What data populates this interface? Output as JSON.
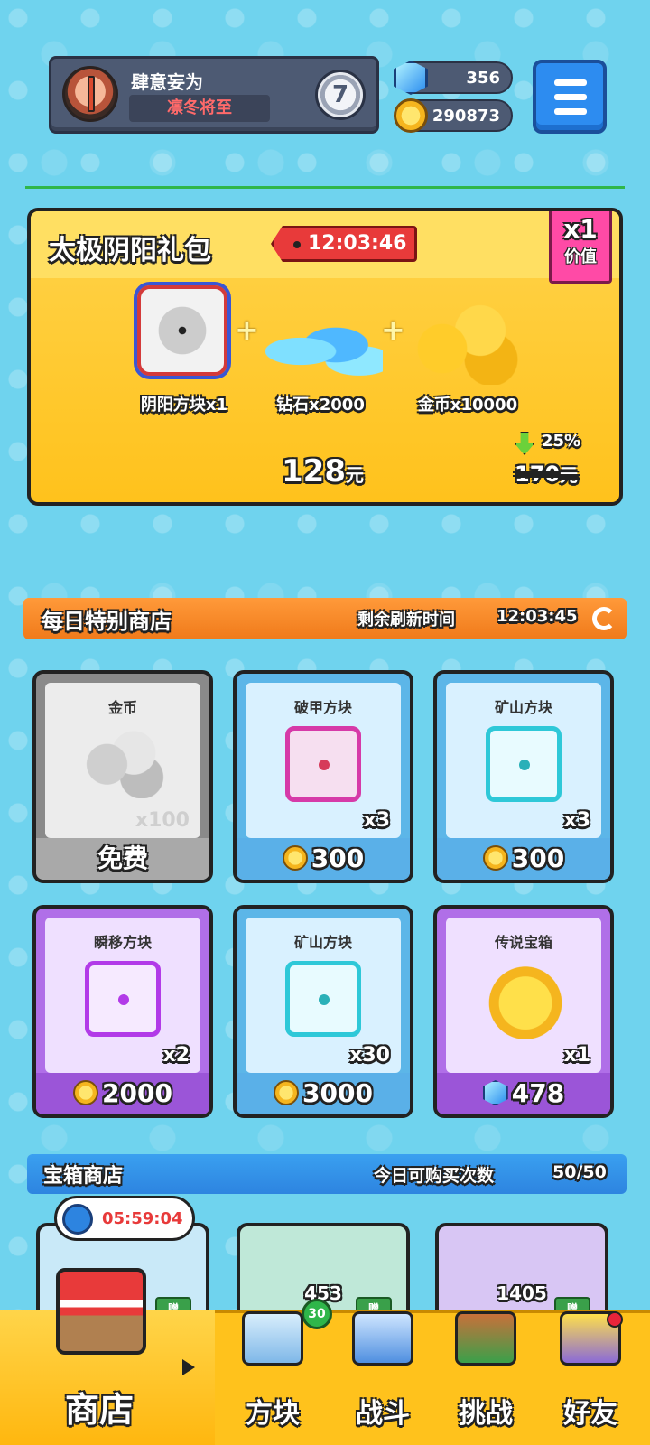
{
  "header": {
    "player_name": "肆意妄为",
    "player_title": "凛冬将至",
    "rank": "7",
    "gems": "356",
    "coins": "290873"
  },
  "gift_pack": {
    "title": "太极阴阳礼包",
    "timer": "12:03:46",
    "multiplier": "x1",
    "multiplier_label": "价值",
    "items": [
      {
        "label": "阴阳方块x1"
      },
      {
        "label": "钻石x2000"
      },
      {
        "label": "金币x10000"
      }
    ],
    "discount": "25%",
    "price": "128",
    "price_unit": "元",
    "original_price": "170",
    "original_unit": "元"
  },
  "daily_shop": {
    "title": "每日特别商店",
    "refresh_label": "剩余刷新时间",
    "refresh_time": "12:03:45",
    "items": [
      {
        "name": "金币",
        "qty": "x100",
        "price": "免费"
      },
      {
        "name": "破甲方块",
        "qty": "x3",
        "price": "300"
      },
      {
        "name": "矿山方块",
        "qty": "x3",
        "price": "300"
      },
      {
        "name": "瞬移方块",
        "qty": "x2",
        "price": "2000"
      },
      {
        "name": "矿山方块",
        "qty": "x30",
        "price": "3000"
      },
      {
        "name": "传说宝箱",
        "qty": "x1",
        "price": "478"
      }
    ]
  },
  "chest_shop": {
    "title": "宝箱商店",
    "count_label": "今日可购买次数",
    "count": "50/50",
    "timer": "05:59:04",
    "chests": [
      {
        "num": "",
        "badge": "赠"
      },
      {
        "num": "453",
        "badge": "赠",
        "level": "30"
      },
      {
        "num": "1405",
        "badge": "赠"
      }
    ]
  },
  "bottom_nav": {
    "items": [
      {
        "label": "商店"
      },
      {
        "label": "方块"
      },
      {
        "label": "战斗"
      },
      {
        "label": "挑战"
      },
      {
        "label": "好友"
      }
    ]
  },
  "colors": {
    "background": "#6fd3ee",
    "accent_orange": "#f07a1a",
    "accent_blue": "#2d84e0",
    "pack_yellow": "#ffc21c",
    "timer_red": "#e83a3a"
  }
}
